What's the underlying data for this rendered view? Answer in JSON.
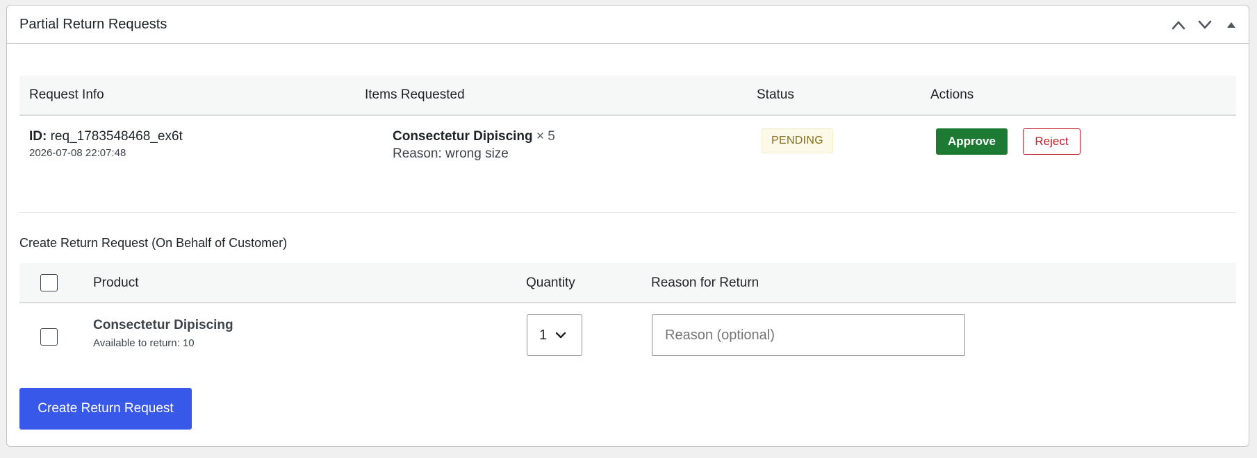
{
  "panel": {
    "title": "Partial Return Requests",
    "controls": {
      "move_up_icon": "chevron-up-icon",
      "move_down_icon": "chevron-down-icon",
      "toggle_icon": "triangle-up-icon"
    }
  },
  "requests_table": {
    "headers": [
      "Request Info",
      "Items Requested",
      "Status",
      "Actions"
    ],
    "rows": [
      {
        "id_label": "ID:",
        "id_value": "req_1783548468_ex6t",
        "date": "2026-07-08 22:07:48",
        "item_name": "Consectetur Dipiscing",
        "item_qty": "× 5",
        "item_reason": "Reason: wrong size",
        "status": "PENDING",
        "approve_label": "Approve",
        "reject_label": "Reject"
      }
    ]
  },
  "create_section": {
    "title": "Create Return Request (On Behalf of Customer)",
    "headers": {
      "product": "Product",
      "quantity": "Quantity",
      "reason": "Reason for Return"
    },
    "rows": [
      {
        "product_name": "Consectetur Dipiscing",
        "available": "Available to return: 10",
        "quantity": "1",
        "reason_placeholder": "Reason (optional)",
        "reason_value": ""
      }
    ],
    "submit_label": "Create Return Request"
  },
  "colors": {
    "approve": "#1d7a33",
    "reject": "#c0202e",
    "primary": "#3858e9",
    "pending_bg": "#fcf9e8",
    "pending_text": "#8a6d1b"
  }
}
